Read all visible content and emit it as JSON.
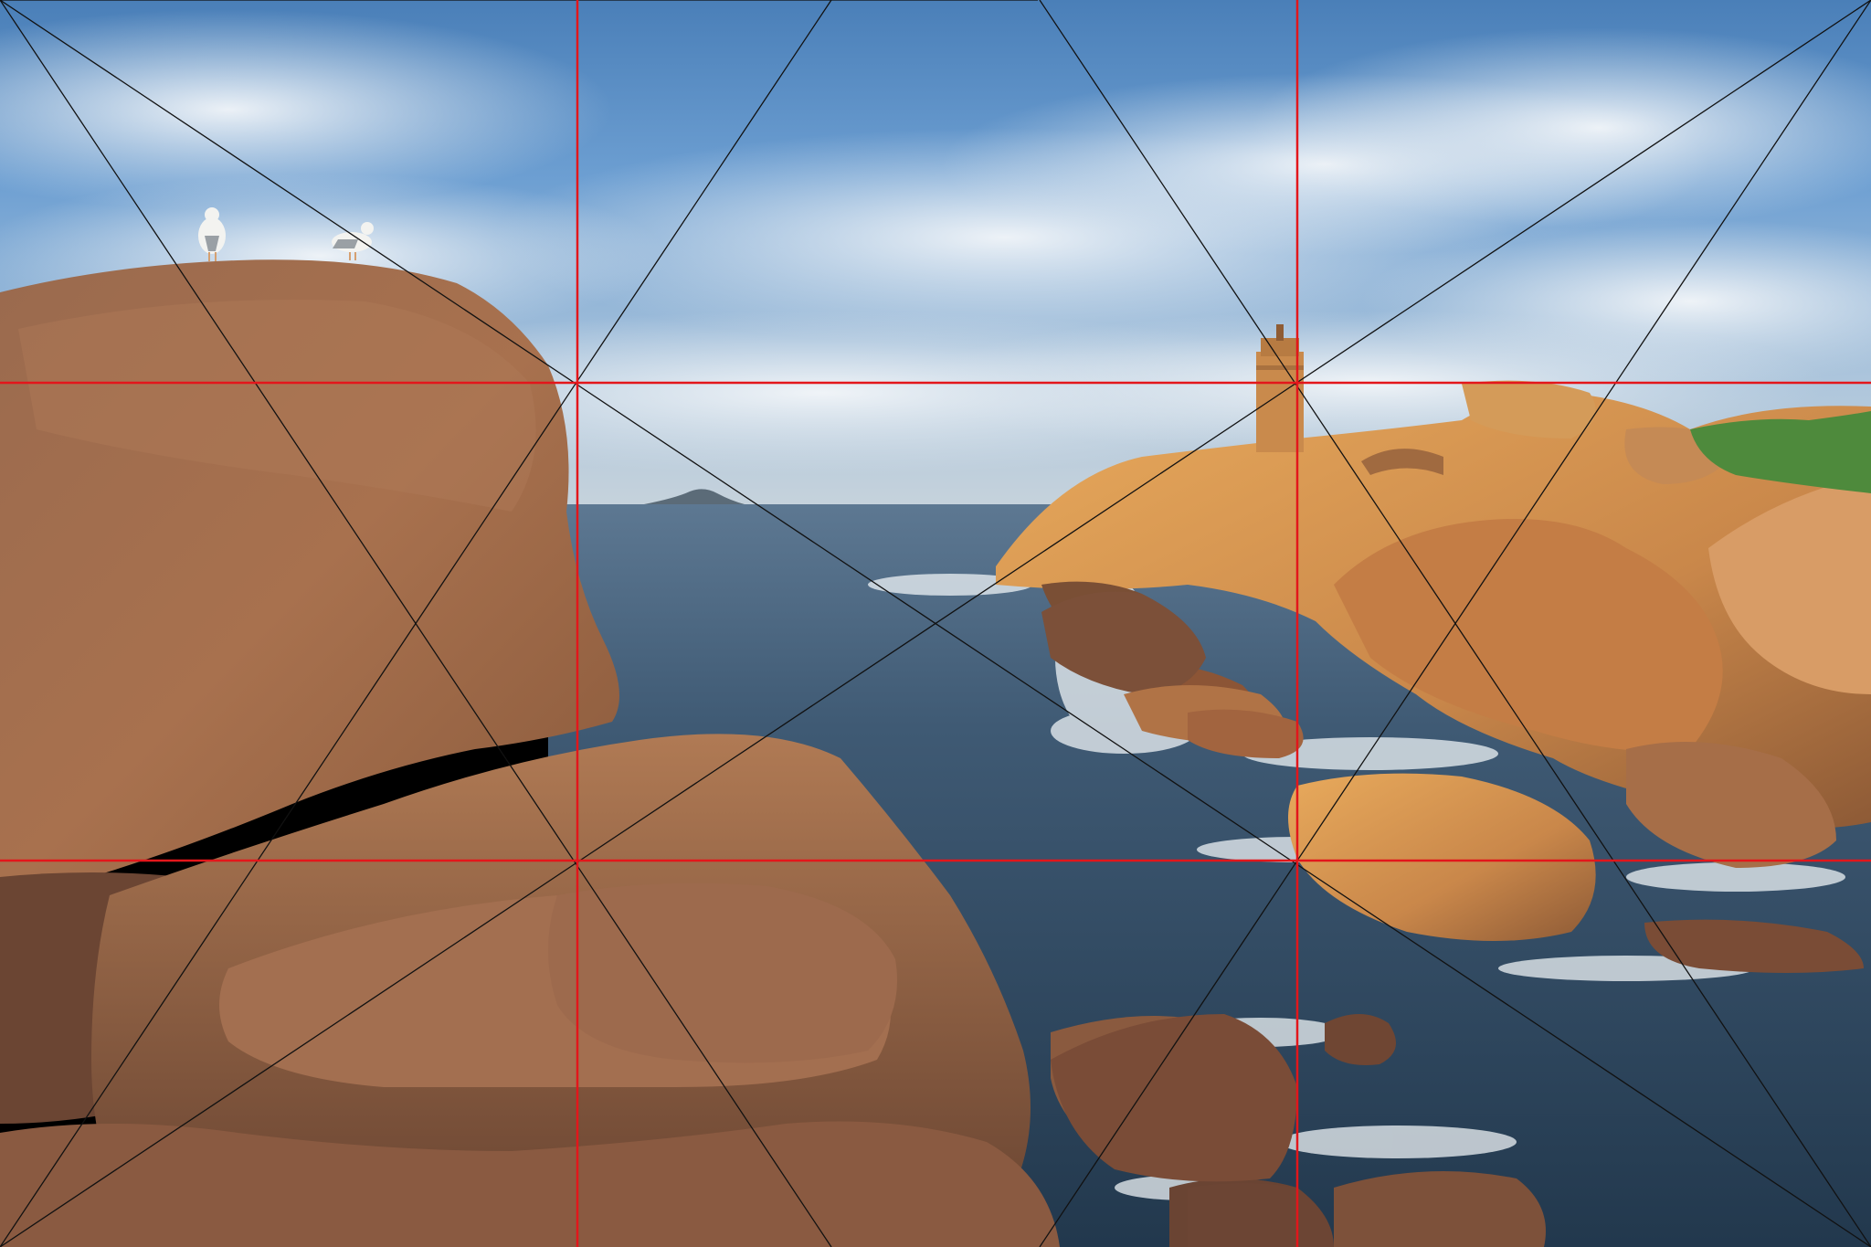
{
  "image": {
    "subject": "coastal-granite-rocks-lighthouse-seagulls"
  },
  "colors": {
    "sky_top": "#3f7fc4",
    "sky_mid": "#8fb4d8",
    "cloud": "#e9eef3",
    "horizon": "#b9c7d3",
    "sea_far": "#4d6a86",
    "sea_near": "#24384c",
    "foam": "#f2f6f8",
    "rock_sunlit": "#d99a4e",
    "rock_mid": "#b8784a",
    "rock_shadow": "#6d4630",
    "foreground_rock": "#a7714f",
    "foreground_dark": "#5e3d2c",
    "lighthouse": "#c98a4c",
    "grass": "#4e8a3c",
    "seagull": "#f3f3f0",
    "grid_line": "#e3161b",
    "diagonal_line": "#111111"
  },
  "overlay": {
    "grid": "rule-of-thirds",
    "diagonals": "corner-to-corner-and-thirds"
  }
}
